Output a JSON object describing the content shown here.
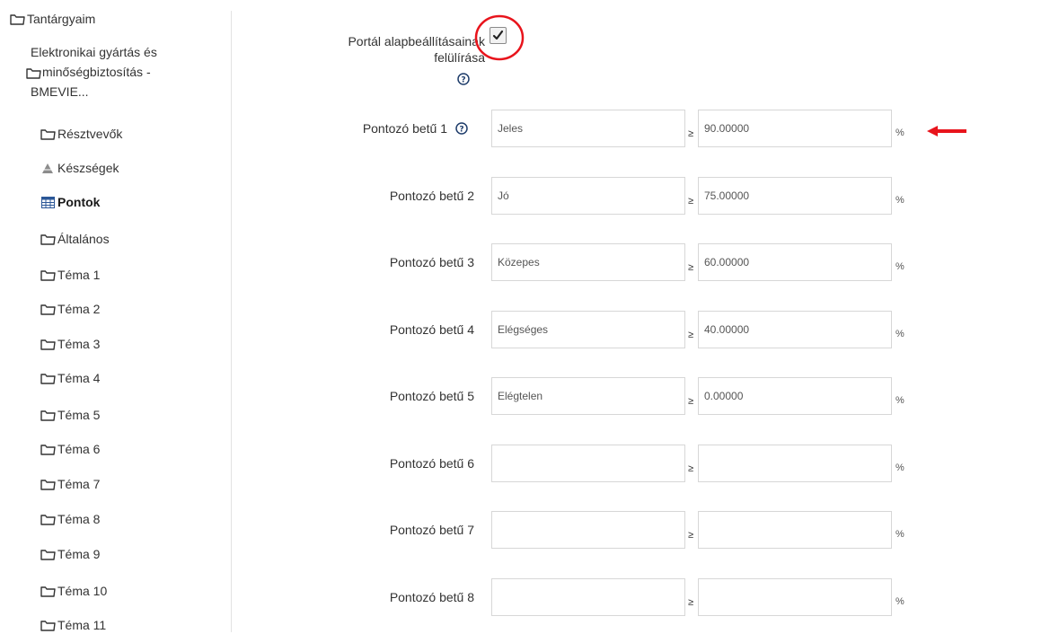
{
  "sidebar": {
    "root": "Tantárgyaim",
    "course_lines": [
      "Elektronikai gyártás és",
      "minőségbiztosítás -",
      "BMEVIE..."
    ],
    "items": [
      {
        "label": "Résztvevők",
        "icon": "folder-icon"
      },
      {
        "label": "Készségek",
        "icon": "triangle-icon"
      },
      {
        "label": "Pontok",
        "icon": "table-icon",
        "active": true
      },
      {
        "label": "Általános",
        "icon": "folder-icon"
      },
      {
        "label": "Téma 1",
        "icon": "folder-icon"
      },
      {
        "label": "Téma 2",
        "icon": "folder-icon"
      },
      {
        "label": "Téma 3",
        "icon": "folder-icon"
      },
      {
        "label": "Téma 4",
        "icon": "folder-icon"
      },
      {
        "label": "Téma 5",
        "icon": "folder-icon"
      },
      {
        "label": "Téma 6",
        "icon": "folder-icon"
      },
      {
        "label": "Téma 7",
        "icon": "folder-icon"
      },
      {
        "label": "Téma 8",
        "icon": "folder-icon"
      },
      {
        "label": "Téma 9",
        "icon": "folder-icon"
      },
      {
        "label": "Téma 10",
        "icon": "folder-icon"
      },
      {
        "label": "Téma 11",
        "icon": "folder-icon"
      }
    ]
  },
  "form": {
    "override_label_line1": "Portál alapbeállításainak",
    "override_label_line2": "felülírása",
    "override_checked": true,
    "ge_symbol": "≥",
    "percent_symbol": "%",
    "rows": [
      {
        "label": "Pontozó betű 1",
        "letter": "Jeles",
        "boundary": "90.00000",
        "help": true
      },
      {
        "label": "Pontozó betű 2",
        "letter": "Jó",
        "boundary": "75.00000"
      },
      {
        "label": "Pontozó betű 3",
        "letter": "Közepes",
        "boundary": "60.00000"
      },
      {
        "label": "Pontozó betű 4",
        "letter": "Elégséges",
        "boundary": "40.00000"
      },
      {
        "label": "Pontozó betű 5",
        "letter": "Elégtelen",
        "boundary": "0.00000"
      },
      {
        "label": "Pontozó betű 6",
        "letter": "",
        "boundary": ""
      },
      {
        "label": "Pontozó betű 7",
        "letter": "",
        "boundary": ""
      },
      {
        "label": "Pontozó betű 8",
        "letter": "",
        "boundary": ""
      }
    ]
  },
  "annotations": {
    "highlight_color": "#e8141c",
    "arrow_color": "#e8141c"
  }
}
